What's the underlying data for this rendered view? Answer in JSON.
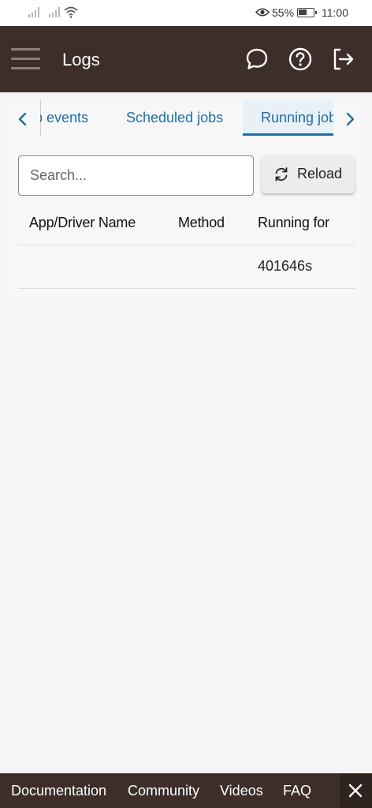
{
  "status_bar": {
    "battery_percent": "55%",
    "time": "11:00",
    "icons": [
      "signal-icon",
      "signal-icon",
      "wifi-icon",
      "eye-icon",
      "battery-icon"
    ]
  },
  "header": {
    "title": "Logs",
    "icons": [
      "chat-icon",
      "help-icon",
      "logout-icon"
    ]
  },
  "tabs": {
    "items": [
      {
        "label": "App events",
        "active": false
      },
      {
        "label": "Scheduled jobs",
        "active": false
      },
      {
        "label": "Running jobs",
        "active": true
      }
    ]
  },
  "search": {
    "placeholder": "Search...",
    "value": ""
  },
  "toolbar": {
    "reload_label": "Reload"
  },
  "table": {
    "columns": [
      "App/Driver Name",
      "Method",
      "Running for"
    ],
    "rows": [
      {
        "name": "",
        "method": "",
        "running_for": "401646s"
      }
    ]
  },
  "footer": {
    "links": [
      "Documentation",
      "Community",
      "Videos",
      "FAQ"
    ]
  },
  "colors": {
    "header_bg": "#3d2e29",
    "accent": "#1f6fa8",
    "page_bg": "#f5f5f5"
  }
}
